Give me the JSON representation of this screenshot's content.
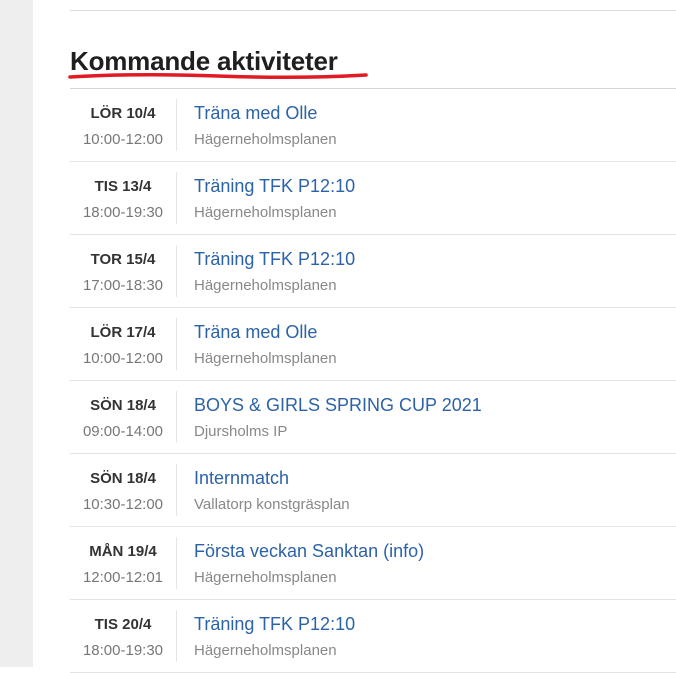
{
  "section": {
    "heading": "Kommande aktiviteter",
    "underline_color": "#e01b24",
    "link_color": "#2c62a8"
  },
  "activities": [
    {
      "date": "LÖR 10/4",
      "time": "10:00-12:00",
      "title": "Träna med Olle",
      "place": "Hägerneholmsplanen"
    },
    {
      "date": "TIS 13/4",
      "time": "18:00-19:30",
      "title": "Träning TFK P12:10",
      "place": "Hägerneholmsplanen"
    },
    {
      "date": "TOR 15/4",
      "time": "17:00-18:30",
      "title": "Träning TFK P12:10",
      "place": "Hägerneholmsplanen"
    },
    {
      "date": "LÖR 17/4",
      "time": "10:00-12:00",
      "title": "Träna med Olle",
      "place": "Hägerneholmsplanen"
    },
    {
      "date": "SÖN 18/4",
      "time": "09:00-14:00",
      "title": "BOYS & GIRLS SPRING CUP 2021",
      "place": "Djursholms IP"
    },
    {
      "date": "SÖN 18/4",
      "time": "10:30-12:00",
      "title": "Internmatch",
      "place": "Vallatorp konstgräsplan"
    },
    {
      "date": "MÅN 19/4",
      "time": "12:00-12:01",
      "title": "Första veckan Sanktan (info)",
      "place": "Hägerneholmsplanen"
    },
    {
      "date": "TIS 20/4",
      "time": "18:00-19:30",
      "title": "Träning TFK P12:10",
      "place": "Hägerneholmsplanen"
    }
  ]
}
